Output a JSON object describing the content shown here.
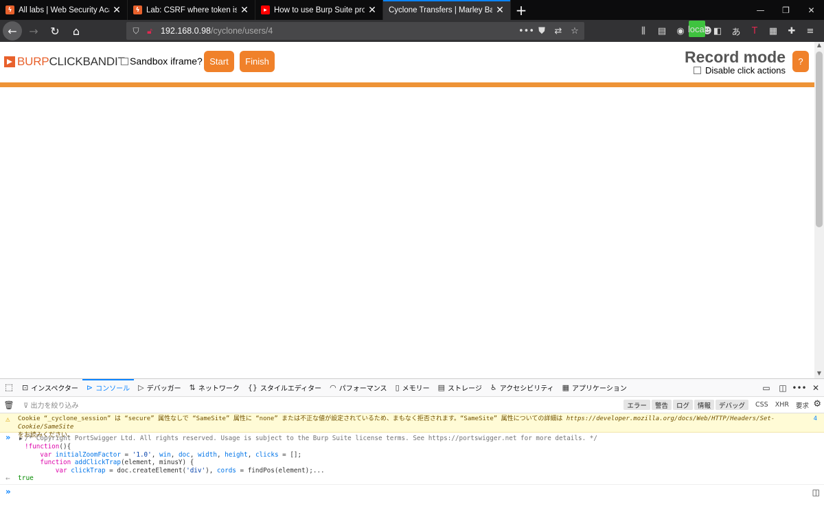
{
  "tabs": [
    {
      "title": "All labs | Web Security Academy",
      "icon": "burp",
      "active": false
    },
    {
      "title": "Lab: CSRF where token is not tied to user session",
      "icon": "burp",
      "active": false
    },
    {
      "title": "How to use Burp Suite projects",
      "icon": "youtube",
      "active": false
    },
    {
      "title": "Cyclone Transfers | Marley Barton",
      "icon": "none",
      "active": true
    }
  ],
  "url": {
    "host": "192.168.0.98",
    "path": "/cyclone/users/4"
  },
  "extension_badge": "local",
  "clickbandit": {
    "logo_burp": "BURP",
    "logo_bandit": "CLICKBANDIT",
    "sandbox_label": "Sandbox iframe?",
    "start_label": "Start",
    "finish_label": "Finish",
    "mode_title": "Record mode",
    "disable_label": "Disable click actions",
    "help_label": "?",
    "accent_color": "#f0812a"
  },
  "devtools": {
    "tabs": [
      {
        "label": "インスペクター",
        "icon": "inspector-icon"
      },
      {
        "label": "コンソール",
        "icon": "console-icon",
        "active": true
      },
      {
        "label": "デバッガー",
        "icon": "debugger-icon"
      },
      {
        "label": "ネットワーク",
        "icon": "network-icon"
      },
      {
        "label": "スタイルエディター",
        "icon": "style-icon"
      },
      {
        "label": "パフォーマンス",
        "icon": "performance-icon"
      },
      {
        "label": "メモリー",
        "icon": "memory-icon"
      },
      {
        "label": "ストレージ",
        "icon": "storage-icon"
      },
      {
        "label": "アクセシビリティ",
        "icon": "accessibility-icon"
      },
      {
        "label": "アプリケーション",
        "icon": "application-icon"
      }
    ],
    "filter_placeholder": "出力を絞り込み",
    "levels": [
      "エラー",
      "警告",
      "ログ",
      "情報",
      "デバッグ"
    ],
    "types": [
      "CSS",
      "XHR",
      "要求"
    ],
    "warning": {
      "line1": "Cookie “_cyclone_session” は “secure” 属性なしで “SameSite” 属性に “none” または不正な値が設定されているため、まもなく拒否されます。“SameSite” 属性についての詳細は ",
      "link": "https://developer.mozilla.org/docs/Web/HTTP/Headers/Set-Cookie/SameSite",
      "line2": "をお読みください。",
      "count": "4"
    },
    "code": {
      "comment": "/* Copyright PortSwigger Ltd. All rights reserved. Usage is subject to the Burp Suite license terms. See https://portswigger.net for more details. */",
      "line2_kw": "!function",
      "line2_rest": "(){",
      "line3_kw": "var",
      "line3_rest_a": "initialZoomFactor",
      "line3_rest_b": " = ",
      "line3_str": "'1.0'",
      "line3_rest_c": ", ",
      "line3_vars": [
        "win",
        "doc",
        "width",
        "height",
        "clicks"
      ],
      "line3_end": " = [];",
      "line4_kw": "function",
      "line4_name": "addClickTrap",
      "line4_args": "(element, minusY) {",
      "line5_kw": "var",
      "line5_a": "clickTrap",
      "line5_b": " = doc.createElement(",
      "line5_str": "'div'",
      "line5_c": "), ",
      "line5_d": "cords",
      "line5_e": " = findPos(element);..."
    },
    "result": "true"
  }
}
